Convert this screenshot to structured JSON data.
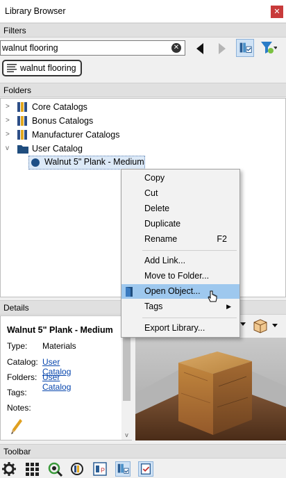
{
  "window": {
    "title": "Library Browser",
    "close_icon": "close-icon"
  },
  "filters": {
    "header": "Filters",
    "search_value": "walnut flooring",
    "chip_label": "walnut flooring"
  },
  "folders": {
    "header": "Folders",
    "items": [
      {
        "label": "Core Catalogs"
      },
      {
        "label": "Bonus Catalogs"
      },
      {
        "label": "Manufacturer Catalogs"
      },
      {
        "label": "User Catalog"
      }
    ],
    "selected_item": "Walnut 5\" Plank - Medium"
  },
  "context_menu": {
    "items": [
      {
        "label": "Copy",
        "shortcut": ""
      },
      {
        "label": "Cut",
        "shortcut": ""
      },
      {
        "label": "Delete",
        "shortcut": ""
      },
      {
        "label": "Duplicate",
        "shortcut": ""
      },
      {
        "label": "Rename",
        "shortcut": "F2"
      },
      {
        "label": "Add Link...",
        "shortcut": ""
      },
      {
        "label": "Move to Folder...",
        "shortcut": ""
      },
      {
        "label": "Open Object...",
        "shortcut": ""
      },
      {
        "label": "Tags",
        "shortcut": ""
      },
      {
        "label": "Export Library...",
        "shortcut": ""
      }
    ],
    "highlighted": "Open Object..."
  },
  "details": {
    "header": "Details",
    "title": "Walnut 5\" Plank - Medium",
    "type_label": "Type:",
    "type_value": "Materials",
    "catalog_label": "Catalog:",
    "catalog_value": "User Catalog",
    "folders_label": "Folders:",
    "folders_value": "User Catalog",
    "tags_label": "Tags:",
    "notes_label": "Notes:"
  },
  "toolbar": {
    "header": "Toolbar"
  },
  "colors": {
    "selection": "#dce9f7",
    "menu_highlight": "#9ec8ee",
    "link": "#0645ad",
    "close": "#c83a3a"
  }
}
